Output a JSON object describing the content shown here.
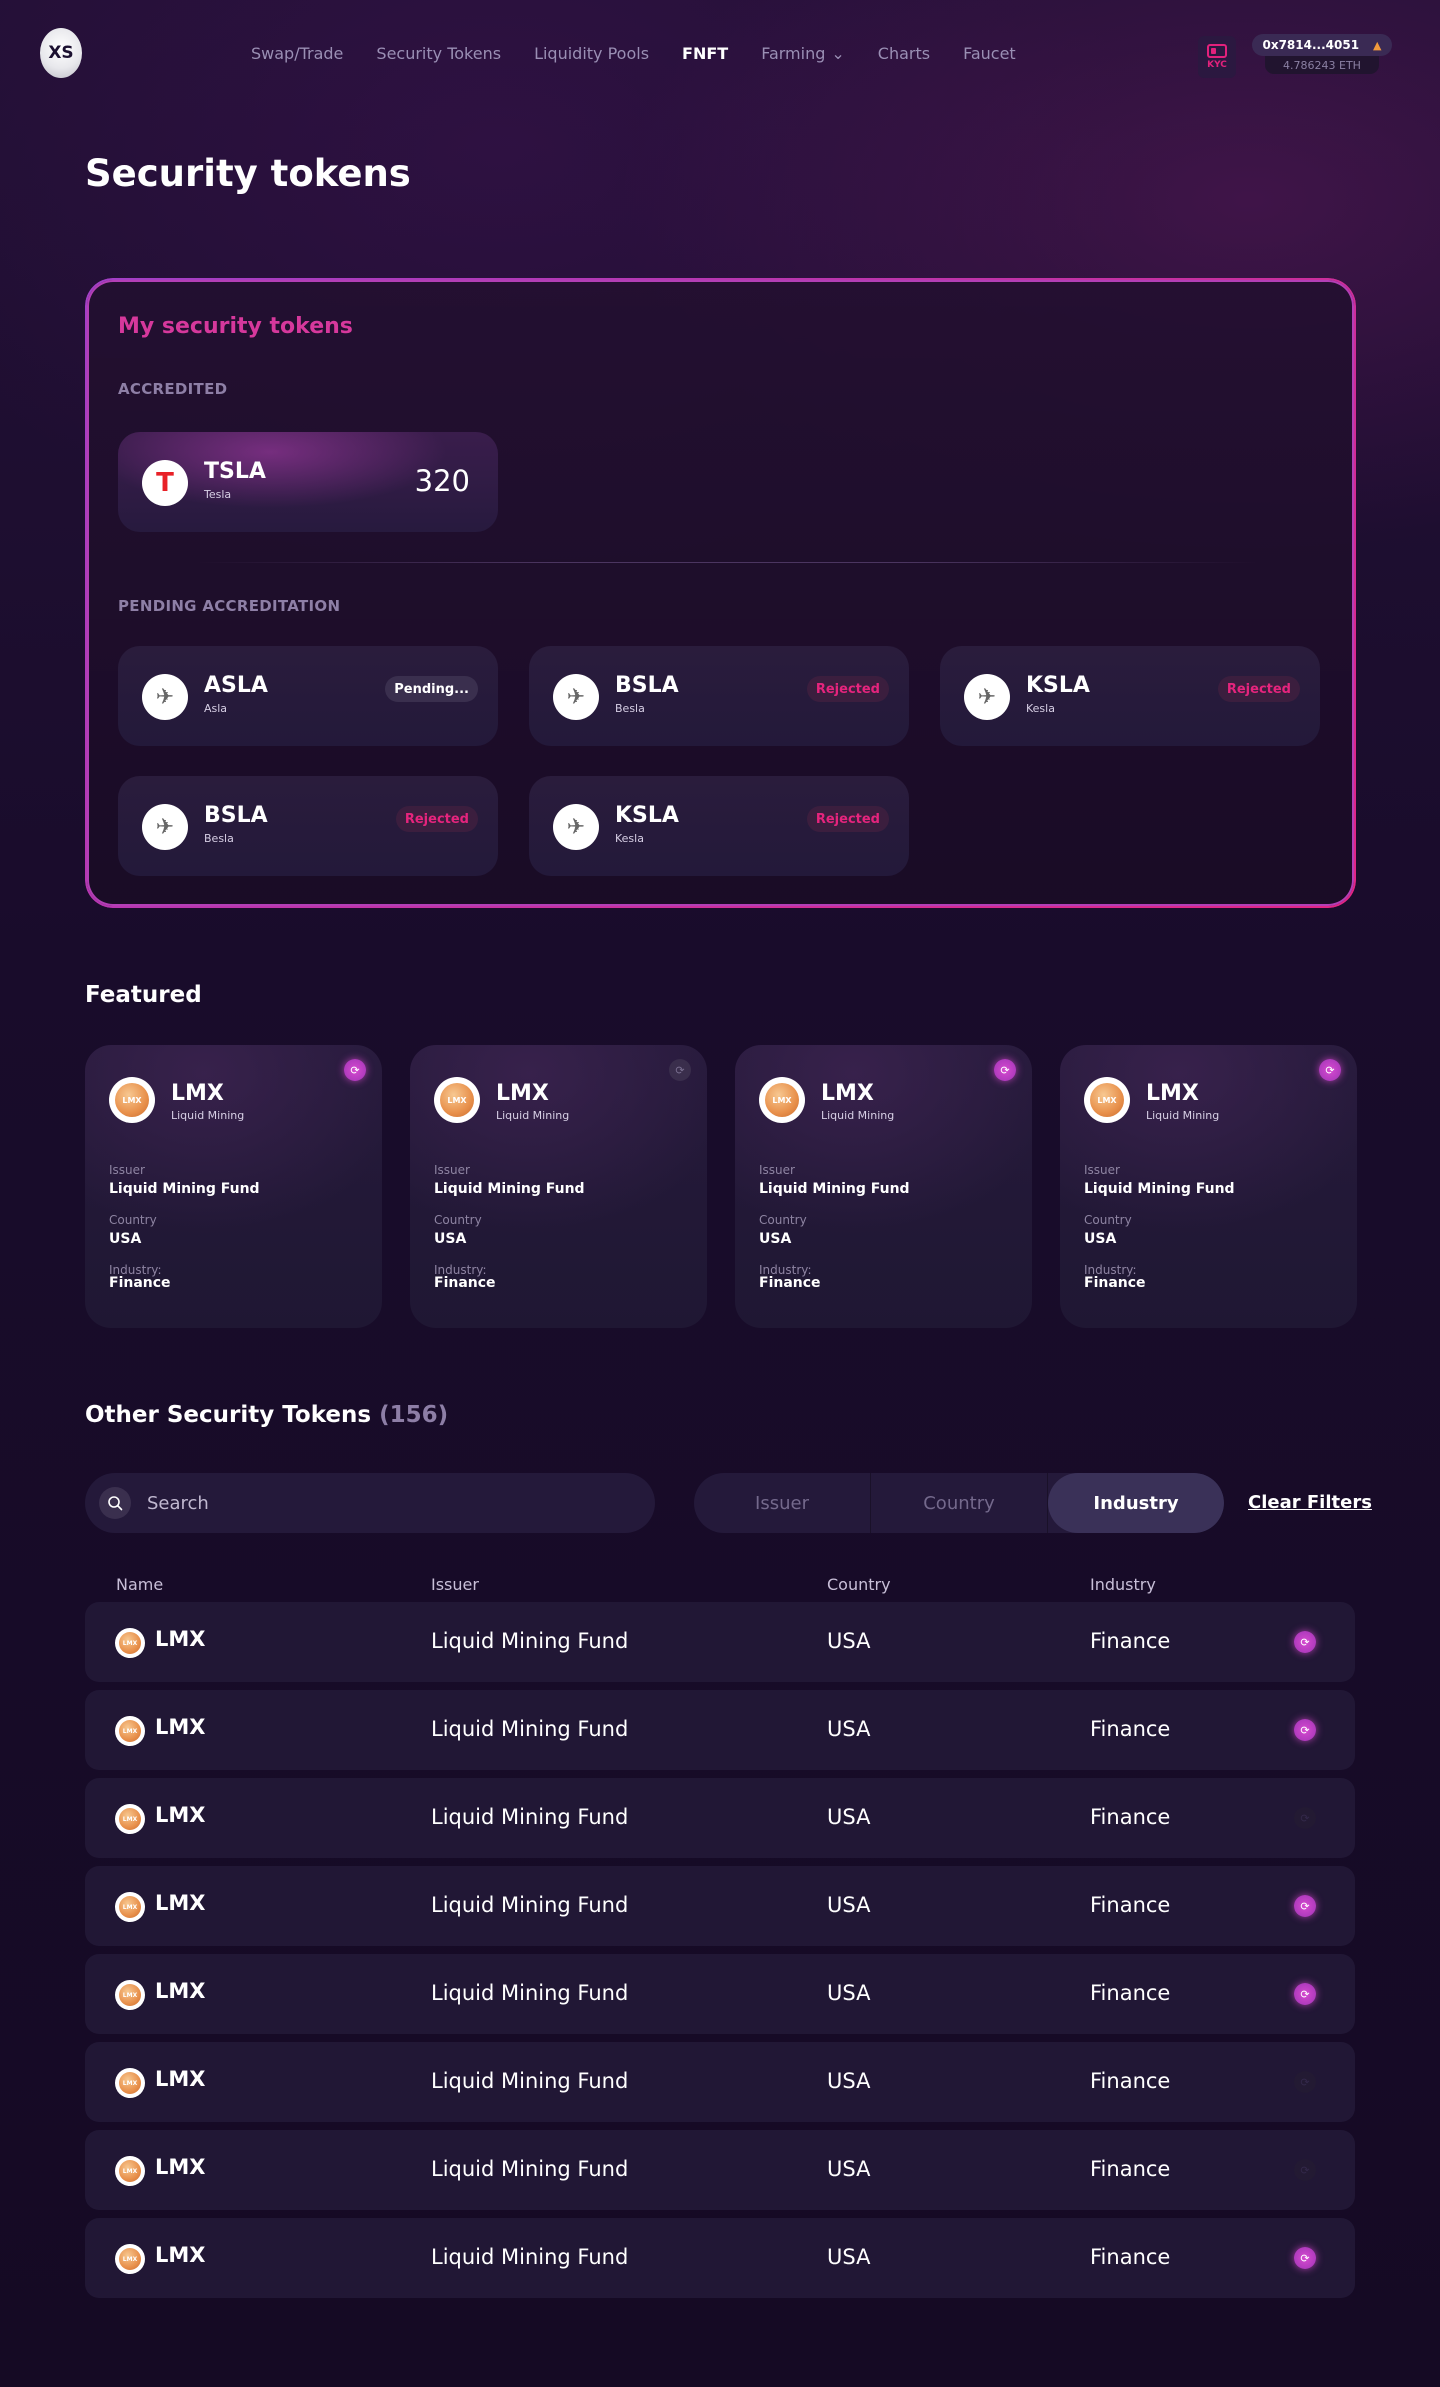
{
  "header": {
    "logo_text": "XS",
    "nav": [
      {
        "label": "Swap/Trade",
        "active": false,
        "dropdown": false
      },
      {
        "label": "Security Tokens",
        "active": false,
        "dropdown": false
      },
      {
        "label": "Liquidity Pools",
        "active": false,
        "dropdown": false
      },
      {
        "label": "FNFT",
        "active": true,
        "dropdown": false
      },
      {
        "label": "Farming",
        "active": false,
        "dropdown": true
      },
      {
        "label": "Charts",
        "active": false,
        "dropdown": false
      },
      {
        "label": "Faucet",
        "active": false,
        "dropdown": false
      }
    ],
    "kyc_label": "KYC",
    "wallet_address": "0x7814...4051",
    "wallet_balance": "4.786243 ETH"
  },
  "page_title": "Security tokens",
  "my_tokens": {
    "title": "My security tokens",
    "accredited_label": "ACCREDITED",
    "pending_label": "PENDING ACCREDITATION",
    "accredited": [
      {
        "symbol": "TSLA",
        "name": "Tesla",
        "amount": "320",
        "icon": "tesla-logo-icon"
      }
    ],
    "pending": [
      {
        "symbol": "ASLA",
        "name": "Asla",
        "status": "Pending...",
        "status_type": "pending",
        "icon": "token-logo-icon"
      },
      {
        "symbol": "BSLA",
        "name": "Besla",
        "status": "Rejected",
        "status_type": "rejected",
        "icon": "token-logo-icon"
      },
      {
        "symbol": "KSLA",
        "name": "Kesla",
        "status": "Rejected",
        "status_type": "rejected",
        "icon": "token-logo-icon"
      },
      {
        "symbol": "BSLA",
        "name": "Besla",
        "status": "Rejected",
        "status_type": "rejected",
        "icon": "token-logo-icon"
      },
      {
        "symbol": "KSLA",
        "name": "Kesla",
        "status": "Rejected",
        "status_type": "rejected",
        "icon": "token-logo-icon"
      }
    ]
  },
  "featured": {
    "title": "Featured",
    "issuer_label": "Issuer",
    "country_label": "Country",
    "industry_label": "Industry:",
    "cards": [
      {
        "symbol": "LMX",
        "name": "Liquid Mining",
        "issuer": "Liquid Mining Fund",
        "country": "USA",
        "industry": "Finance",
        "sync": "on"
      },
      {
        "symbol": "LMX",
        "name": "Liquid Mining",
        "issuer": "Liquid Mining Fund",
        "country": "USA",
        "industry": "Finance",
        "sync": "off"
      },
      {
        "symbol": "LMX",
        "name": "Liquid Mining",
        "issuer": "Liquid Mining Fund",
        "country": "USA",
        "industry": "Finance",
        "sync": "on"
      },
      {
        "symbol": "LMX",
        "name": "Liquid Mining",
        "issuer": "Liquid Mining Fund",
        "country": "USA",
        "industry": "Finance",
        "sync": "on"
      }
    ]
  },
  "other": {
    "title": "Other Security Tokens",
    "count": "(156)",
    "search_placeholder": "Search",
    "filters": [
      {
        "label": "Issuer",
        "active": false
      },
      {
        "label": "Country",
        "active": false
      },
      {
        "label": "Industry",
        "active": true
      }
    ],
    "clear_filters": "Clear Filters",
    "columns": [
      "Name",
      "Issuer",
      "Country",
      "Industry"
    ],
    "rows": [
      {
        "symbol": "LMX",
        "issuer": "Liquid Mining Fund",
        "country": "USA",
        "industry": "Finance",
        "sync": "on"
      },
      {
        "symbol": "LMX",
        "issuer": "Liquid Mining Fund",
        "country": "USA",
        "industry": "Finance",
        "sync": "on"
      },
      {
        "symbol": "LMX",
        "issuer": "Liquid Mining Fund",
        "country": "USA",
        "industry": "Finance",
        "sync": "dim"
      },
      {
        "symbol": "LMX",
        "issuer": "Liquid Mining Fund",
        "country": "USA",
        "industry": "Finance",
        "sync": "on"
      },
      {
        "symbol": "LMX",
        "issuer": "Liquid Mining Fund",
        "country": "USA",
        "industry": "Finance",
        "sync": "on"
      },
      {
        "symbol": "LMX",
        "issuer": "Liquid Mining Fund",
        "country": "USA",
        "industry": "Finance",
        "sync": "dim"
      },
      {
        "symbol": "LMX",
        "issuer": "Liquid Mining Fund",
        "country": "USA",
        "industry": "Finance",
        "sync": "dim"
      },
      {
        "symbol": "LMX",
        "issuer": "Liquid Mining Fund",
        "country": "USA",
        "industry": "Finance",
        "sync": "on"
      }
    ]
  },
  "colors": {
    "accent_pink": "#e3217c",
    "accent_purple": "#b33fb6",
    "coin_orange": "#e8904b"
  }
}
